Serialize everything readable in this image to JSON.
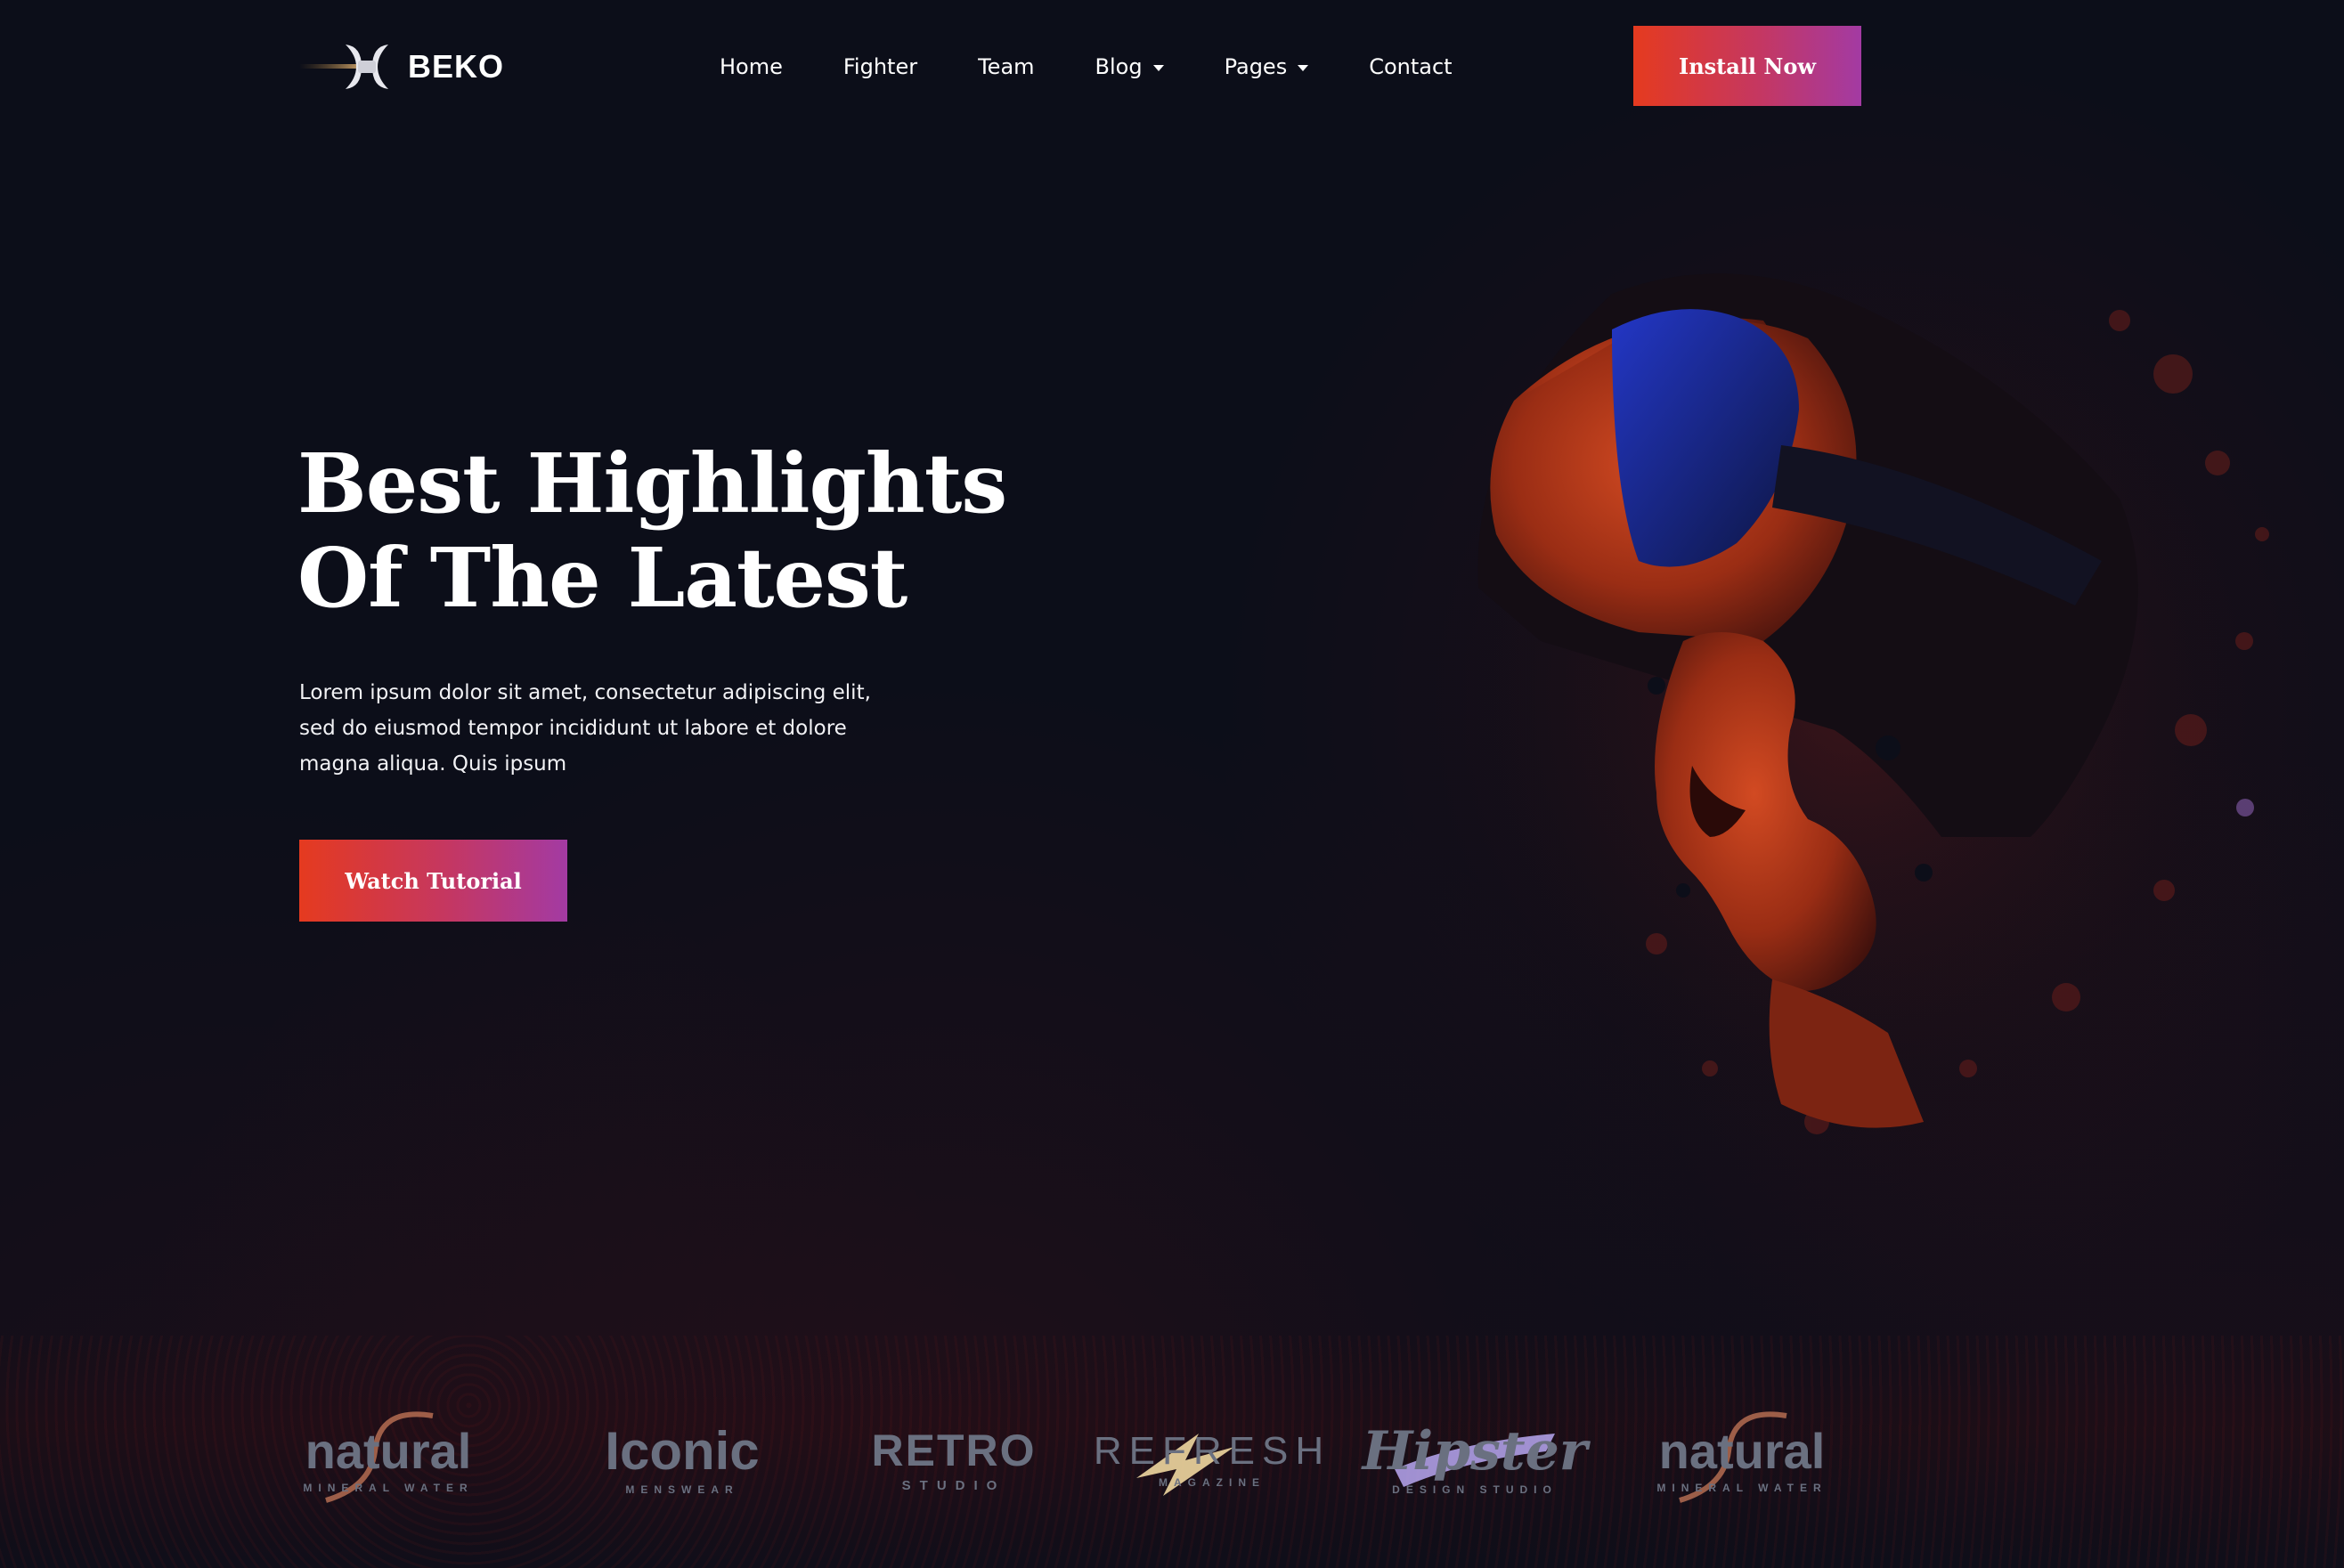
{
  "brand": {
    "name": "BEKO",
    "logo_icon": "double-axe-icon"
  },
  "nav": {
    "items": [
      {
        "label": "Home",
        "dropdown": false
      },
      {
        "label": "Fighter",
        "dropdown": false
      },
      {
        "label": "Team",
        "dropdown": false
      },
      {
        "label": "Blog",
        "dropdown": true
      },
      {
        "label": "Pages",
        "dropdown": true
      },
      {
        "label": "Contact",
        "dropdown": false
      }
    ],
    "cta_label": "Install Now"
  },
  "hero": {
    "title_line1": "Best Highlights",
    "title_line2": "Of The Latest",
    "text": "Lorem ipsum dolor sit amet, consectetur adipiscing elit, sed do eiusmod tempor incididunt ut labore et dolore magna aliqua. Quis ipsum",
    "button_label": "Watch Tutorial"
  },
  "partners": [
    {
      "main": "natural",
      "sub": "MINERAL WATER"
    },
    {
      "main": "Iconic",
      "sub": "MENSWEAR"
    },
    {
      "main": "RETRO",
      "sub": "STUDIO"
    },
    {
      "main": "REFRESH",
      "sub": "MAGAZINE"
    },
    {
      "main": "Hipster",
      "sub": "DESIGN STUDIO"
    },
    {
      "main": "natural",
      "sub": "MINERAL WATER"
    }
  ],
  "colors": {
    "background": "#0c0e19",
    "gradient_start": "#e53a1f",
    "gradient_end": "#a33aa3",
    "logo_muted": "#6a7080"
  }
}
